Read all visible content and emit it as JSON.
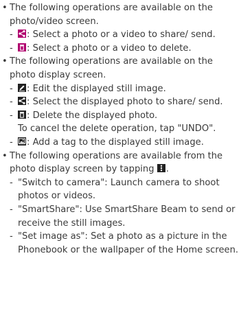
{
  "sections": [
    {
      "bullet": "•",
      "text": "The following operations are available on the photo/video screen.",
      "items": [
        {
          "dash": "-",
          "icon": "share-icon",
          "text": ": Select a photo or a video to share/ send."
        },
        {
          "dash": "-",
          "icon": "trash-icon",
          "text": ": Select a photo or a video to delete."
        }
      ]
    },
    {
      "bullet": "•",
      "text": "The following operations are available on the photo display screen.",
      "items": [
        {
          "dash": "-",
          "icon": "edit-icon",
          "text": ": Edit the displayed still image."
        },
        {
          "dash": "-",
          "icon": "share-icon",
          "text": ": Select the displayed photo to share/ send."
        },
        {
          "dash": "-",
          "icon": "trash-icon",
          "text": ": Delete the displayed photo.",
          "extra": "To cancel the delete operation, tap \"UNDO\"."
        },
        {
          "dash": "-",
          "icon": "tag-icon",
          "text": ": Add a tag to the displayed still image."
        }
      ]
    },
    {
      "bullet": "•",
      "text_before": "The following operations are available from the photo display screen by tapping",
      "text_icon": "menu-icon",
      "text_after": ".",
      "items": [
        {
          "dash": "-",
          "text": "\"Switch to camera\": Launch camera to shoot photos or videos."
        },
        {
          "dash": "-",
          "text": "\"SmartShare\": Use SmartShare Beam to send or receive the still images."
        },
        {
          "dash": "-",
          "text": "\"Set image as\": Set a photo as a picture in the Phonebook or the wallpaper of the Home screen."
        }
      ]
    }
  ]
}
